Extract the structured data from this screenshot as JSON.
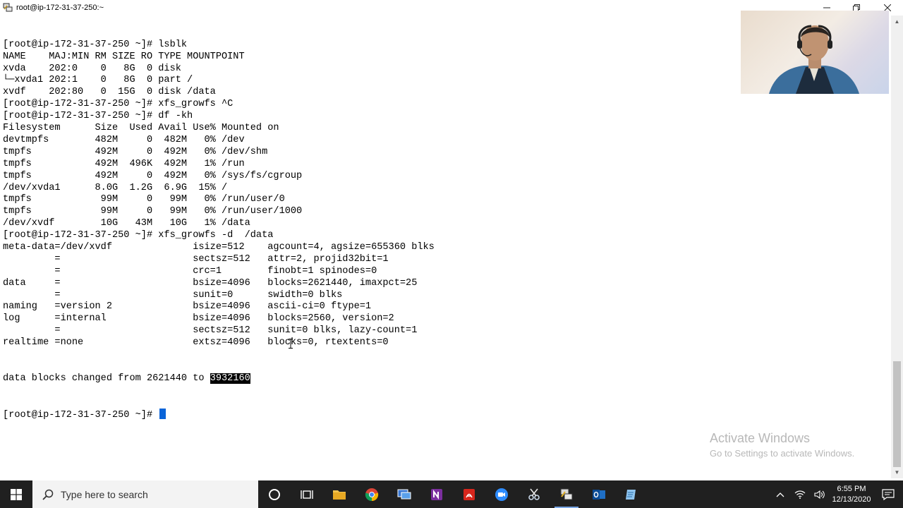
{
  "window": {
    "title": "root@ip-172-31-37-250:~",
    "controls": {
      "minimize": "—",
      "restore": "❐",
      "close": "✕"
    }
  },
  "terminal": {
    "lines": [
      "[root@ip-172-31-37-250 ~]# lsblk",
      "NAME    MAJ:MIN RM SIZE RO TYPE MOUNTPOINT",
      "xvda    202:0    0   8G  0 disk",
      "└─xvda1 202:1    0   8G  0 part /",
      "xvdf    202:80   0  15G  0 disk /data",
      "[root@ip-172-31-37-250 ~]# xfs_growfs ^C",
      "[root@ip-172-31-37-250 ~]# df -kh",
      "Filesystem      Size  Used Avail Use% Mounted on",
      "devtmpfs        482M     0  482M   0% /dev",
      "tmpfs           492M     0  492M   0% /dev/shm",
      "tmpfs           492M  496K  492M   1% /run",
      "tmpfs           492M     0  492M   0% /sys/fs/cgroup",
      "/dev/xvda1      8.0G  1.2G  6.9G  15% /",
      "tmpfs            99M     0   99M   0% /run/user/0",
      "tmpfs            99M     0   99M   0% /run/user/1000",
      "/dev/xvdf        10G   43M   10G   1% /data",
      "[root@ip-172-31-37-250 ~]# xfs_growfs -d  /data",
      "meta-data=/dev/xvdf              isize=512    agcount=4, agsize=655360 blks",
      "         =                       sectsz=512   attr=2, projid32bit=1",
      "         =                       crc=1        finobt=1 spinodes=0",
      "data     =                       bsize=4096   blocks=2621440, imaxpct=25",
      "         =                       sunit=0      swidth=0 blks",
      "naming   =version 2              bsize=4096   ascii-ci=0 ftype=1",
      "log      =internal               bsize=4096   blocks=2560, version=2",
      "         =                       sectsz=512   sunit=0 blks, lazy-count=1",
      "realtime =none                   extsz=4096   blocks=0, rtextents=0"
    ],
    "result_prefix": "data blocks changed from 2621440 to ",
    "result_highlight": "3932160",
    "prompt": "[root@ip-172-31-37-250 ~]# "
  },
  "watermark": {
    "title": "Activate Windows",
    "subtitle": "Go to Settings to activate Windows."
  },
  "taskbar": {
    "search_placeholder": "Type here to search",
    "apps": [
      "cortana-icon",
      "task-view-icon",
      "file-explorer-icon",
      "chrome-icon",
      "remote-desktop-icon",
      "onenote-icon",
      "acrobat-icon",
      "zoom-icon",
      "snipping-tool-icon",
      "putty-icon",
      "outlook-icon",
      "notepad-icon"
    ],
    "tray": {
      "time": "6:55 PM",
      "date": "12/13/2020"
    }
  },
  "colors": {
    "taskbar_bg": "#202020",
    "cursor": "#0a64d8",
    "highlight_bg": "#000000",
    "highlight_fg": "#ffffff"
  }
}
